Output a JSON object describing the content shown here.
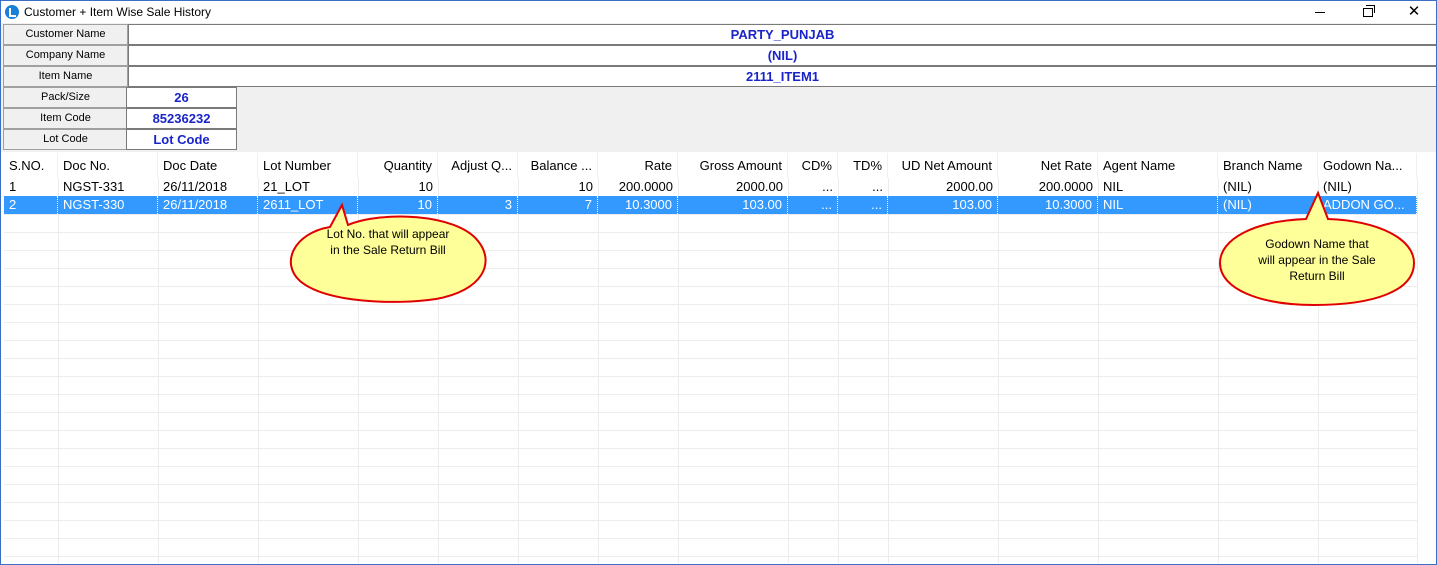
{
  "window": {
    "title": "Customer + Item Wise Sale History",
    "close_glyph": "✕"
  },
  "info": {
    "customer_name_label": "Customer Name",
    "customer_name": "PARTY_PUNJAB",
    "company_name_label": "Company Name",
    "company_name": "(NIL)",
    "item_name_label": "Item Name",
    "item_name": "2111_ITEM1",
    "pack_size_label": "Pack/Size",
    "pack_size": "26",
    "item_code_label": "Item Code",
    "item_code": "85236232",
    "lot_code_label": "Lot Code",
    "lot_code": "Lot Code"
  },
  "table": {
    "columns": [
      "S.NO.",
      "Doc No.",
      "Doc Date",
      "Lot Number",
      "Quantity",
      "Adjust Q...",
      "Balance ...",
      "Rate",
      "Gross Amount",
      "CD%",
      "TD%",
      "UD Net Amount",
      "Net Rate",
      "Agent Name",
      "Branch Name",
      "Godown Na..."
    ],
    "rows": [
      [
        "1",
        "NGST-331",
        "26/11/2018",
        "21_LOT",
        "10",
        "",
        "10",
        "200.0000",
        "2000.00",
        "...",
        "...",
        "2000.00",
        "200.0000",
        "NIL",
        "(NIL)",
        "(NIL)"
      ],
      [
        "2",
        "NGST-330",
        "26/11/2018",
        "2611_LOT",
        "10",
        "3",
        "7",
        "10.3000",
        "103.00",
        "...",
        "...",
        "103.00",
        "10.3000",
        "NIL",
        "(NIL)",
        "ADDON GO..."
      ]
    ],
    "selected_row": 1
  },
  "callouts": {
    "lot": [
      "Lot No. that will appear",
      "in the Sale Return Bill"
    ],
    "godown": [
      "Godown Name that",
      "will appear in the Sale",
      "Return Bill"
    ]
  },
  "colors": {
    "value_text": "#1a24c9",
    "selection": "#3399ff",
    "callout_fill": "#ffff99",
    "callout_border": "#e00000"
  }
}
